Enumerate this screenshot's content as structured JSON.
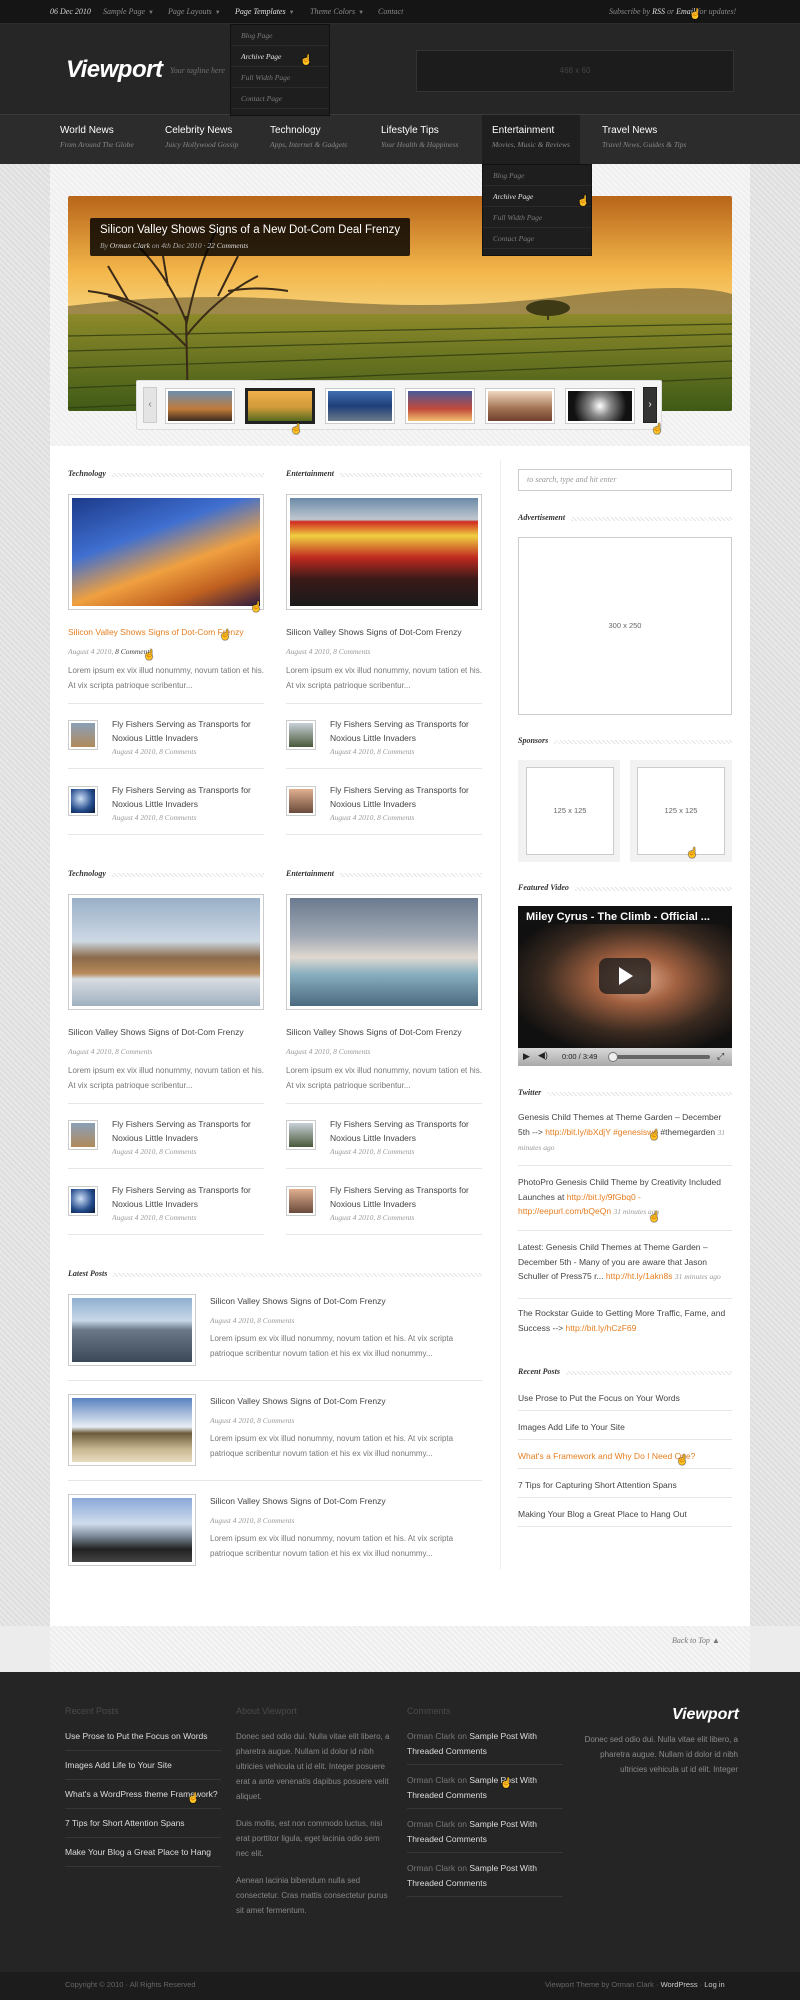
{
  "topbar": {
    "date": "06 Dec 2010",
    "menu": [
      "Sample Page",
      "Page Layouts",
      "Page Templates",
      "Theme Colors",
      "Contact"
    ],
    "subscribe_pre": "Subscribe by",
    "rss": "RSS",
    "or": "or",
    "email": "Email",
    "subscribe_post": "for updates!"
  },
  "templates_dropdown": [
    "Blog Page",
    "Archive Page",
    "Full Width Page",
    "Contact Page"
  ],
  "header": {
    "logo": "Viewport",
    "tagline": "Your tagline here",
    "ad": "468 x 60"
  },
  "nav": [
    {
      "title": "World News",
      "sub": "From Around The Globe"
    },
    {
      "title": "Celebrity News",
      "sub": "Juicy Hollywood Gossip"
    },
    {
      "title": "Technology",
      "sub": "Apps, Internet & Gadgets"
    },
    {
      "title": "Lifestyle Tips",
      "sub": "Your Health & Happiness"
    },
    {
      "title": "Entertainment",
      "sub": "Movies, Music & Reviews"
    },
    {
      "title": "Travel News",
      "sub": "Travel News, Guides & Tips"
    }
  ],
  "entertainment_dropdown": [
    "Blog Page",
    "Archive Page",
    "Full Width Page",
    "Contact Page"
  ],
  "slider": {
    "title": "Silicon Valley Shows Signs of a New Dot-Com Deal Frenzy",
    "by": "By",
    "author": "Orman Clark",
    "on": "on 4th Dec 2010 ·",
    "comments": "22 Comments",
    "prev": "‹",
    "next": "›"
  },
  "columns": [
    {
      "heading": "Technology",
      "title": "Silicon Valley Shows Signs of Dot-Com Frenzy",
      "meta_date": "August 4 2010,",
      "meta_comments": "8 Comments",
      "excerpt": "Lorem ipsum ex vix illud nonummy, novum tation et his. At vix scripta patrioque scribentur...",
      "small": [
        {
          "title": "Fly Fishers Serving as Transports for Noxious Little Invaders",
          "meta": "August 4 2010, 8 Comments"
        },
        {
          "title": "Fly Fishers Serving as Transports for Noxious Little Invaders",
          "meta": "August 4 2010, 8 Comments"
        }
      ]
    },
    {
      "heading": "Entertainment",
      "title": "Silicon Valley Shows Signs of Dot-Com Frenzy",
      "meta_date": "August 4 2010,",
      "meta_comments": "8 Comments",
      "excerpt": "Lorem ipsum ex vix illud nonummy, novum tation et his. At vix scripta patrioque scribentur...",
      "small": [
        {
          "title": "Fly Fishers Serving as Transports for Noxious Little Invaders",
          "meta": "August 4 2010, 8 Comments"
        },
        {
          "title": "Fly Fishers Serving as Transports for Noxious Little Invaders",
          "meta": "August 4 2010, 8 Comments"
        }
      ]
    },
    {
      "heading": "Technology",
      "title": "Silicon Valley Shows Signs of Dot-Com Frenzy",
      "meta_date": "August 4 2010,",
      "meta_comments": "8 Comments",
      "excerpt": "Lorem ipsum ex vix illud nonummy, novum tation et his. At vix scripta patrioque scribentur...",
      "small": [
        {
          "title": "Fly Fishers Serving as Transports for Noxious Little Invaders",
          "meta": "August 4 2010, 8 Comments"
        },
        {
          "title": "Fly Fishers Serving as Transports for Noxious Little Invaders",
          "meta": "August 4 2010, 8 Comments"
        }
      ]
    },
    {
      "heading": "Entertainment",
      "title": "Silicon Valley Shows Signs of Dot-Com Frenzy",
      "meta_date": "August 4 2010,",
      "meta_comments": "8 Comments",
      "excerpt": "Lorem ipsum ex vix illud nonummy, novum tation et his. At vix scripta patrioque scribentur...",
      "small": [
        {
          "title": "Fly Fishers Serving as Transports for Noxious Little Invaders",
          "meta": "August 4 2010, 8 Comments"
        },
        {
          "title": "Fly Fishers Serving as Transports for Noxious Little Invaders",
          "meta": "August 4 2010, 8 Comments"
        }
      ]
    }
  ],
  "latest": {
    "heading": "Latest Posts",
    "posts": [
      {
        "title": "Silicon Valley Shows Signs of Dot-Com Frenzy",
        "meta": "August 4 2010, 8 Comments",
        "excerpt": "Lorem ipsum ex vix illud nonummy, novum tation et his. At vix scripta patrioque scribentur novum tation et his ex vix illud nonummy..."
      },
      {
        "title": "Silicon Valley Shows Signs of Dot-Com Frenzy",
        "meta": "August 4 2010, 8 Comments",
        "excerpt": "Lorem ipsum ex vix illud nonummy, novum tation et his. At vix scripta patrioque scribentur novum tation et his ex vix illud nonummy..."
      },
      {
        "title": "Silicon Valley Shows Signs of Dot-Com Frenzy",
        "meta": "August 4 2010, 8 Comments",
        "excerpt": "Lorem ipsum ex vix illud nonummy, novum tation et his. At vix scripta patrioque scribentur novum tation et his ex vix illud nonummy..."
      }
    ]
  },
  "sidebar": {
    "search_placeholder": "to search, type and hit enter",
    "ad_heading": "Advertisement",
    "ad_size": "300 x 250",
    "sponsors_heading": "Sponsors",
    "sponsor_size": "125 x 125",
    "video_heading": "Featured Video",
    "video_title": "Miley Cyrus - The Climb - Official ...",
    "video_time": "0:00 / 3:49",
    "twitter_heading": "Twitter",
    "tweets": [
      {
        "text": "Genesis Child Themes at Theme Garden – December 5th -->",
        "link": "http://bit.ly/ibXdjY #genesiswp",
        "tail": "#themegarden",
        "time": "31 minutes ago"
      },
      {
        "text": "PhotoPro Genesis Child Theme by Creativity Included Launches at",
        "link": "http://bit.ly/9fGbq0 - http://eepurl.com/bQeQn",
        "tail": "",
        "time": "31 minutes ago"
      },
      {
        "text": "Latest: Genesis Child Themes at Theme Garden – December 5th - Many of you are aware that Jason Schuller of Press75 r...",
        "link": "http://ht.ly/1akn8s",
        "tail": "",
        "time": "31 minutes ago"
      },
      {
        "text": "The Rockstar Guide to Getting More Traffic, Fame, and Success -->",
        "link": "http://bit.ly/hCzF69",
        "tail": "",
        "time": ""
      }
    ],
    "recent_heading": "Recent Posts",
    "recent": [
      "Use Prose to Put the Focus on Your Words",
      "Images Add Life to Your Site",
      "What's a Framework and Why Do I Need One?",
      "7 Tips for Capturing Short Attention Spans",
      "Making Your Blog a Great Place to Hang Out"
    ]
  },
  "back_to_top": "Back to Top",
  "footer": {
    "recent_heading": "Recent Posts",
    "recent": [
      "Use Prose to Put the Focus on Words",
      "Images Add Life to Your Site",
      "What's a WordPress theme Framework?",
      "7 Tips for Short Attention Spans",
      "Make Your Blog a Great Place to Hang"
    ],
    "about_heading": "About Viewport",
    "about": [
      "Donec sed odio dui. Nulla vitae elit libero, a pharetra augue. Nullam id dolor id nibh ultricies vehicula ut id elit. Integer posuere erat a ante venenatis dapibus posuere velit aliquet.",
      "Duis mollis, est non commodo luctus, nisi erat porttitor ligula, eget lacinia odio sem nec elit.",
      "Aenean lacinia bibendum nulla sed consectetur. Cras mattis consectetur purus sit amet fermentum."
    ],
    "comments_heading": "Comments",
    "comment_author": "Orman Clark on",
    "comment_post": "Sample Post With Threaded Comments",
    "logo": "Viewport",
    "logo_text": "Donec sed odio dui. Nulla vitae elit libero, a pharetra augue. Nullam id dolor id nibh ultricies vehicula ut id elit. Integer",
    "copyright": "Copyright © 2010 · All Rights Reserved",
    "credit_pre": "Viewport Theme by Orman Clark ·",
    "wordpress": "WordPress",
    "login": "Log in"
  }
}
